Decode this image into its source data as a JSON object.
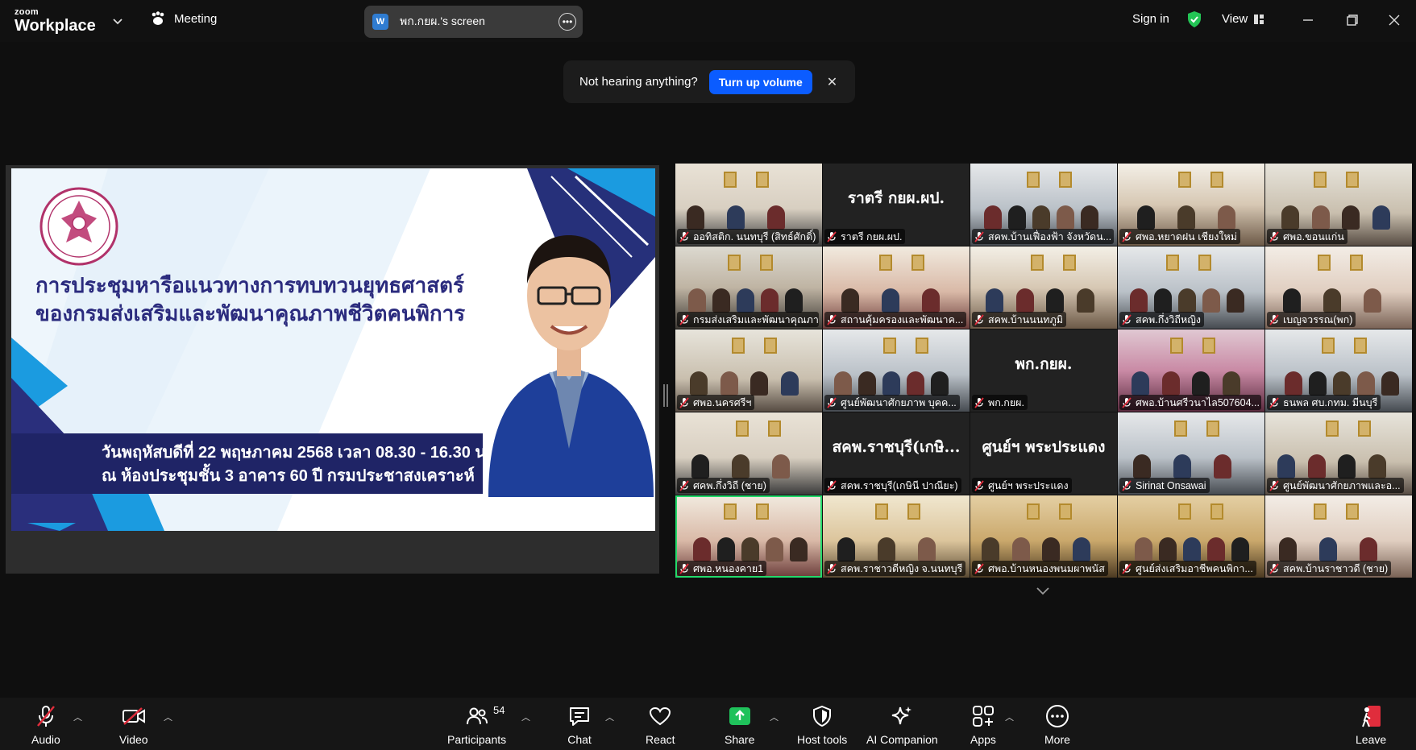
{
  "app": {
    "logo_small": "zoom",
    "logo_big": "Workplace",
    "meeting_label": "Meeting",
    "screen_share_badge": "W",
    "screen_share_title": "พก.กยผ.'s screen",
    "sign_in": "Sign in",
    "view": "View"
  },
  "notice": {
    "message": "Not hearing anything?",
    "button": "Turn up volume"
  },
  "slide": {
    "title_line1": "การประชุมหารือแนวทางการทบทวนยุทธศาสตร์",
    "title_line2": "ของกรมส่งเสริมและพัฒนาคุณภาพชีวิตคนพิการ",
    "date_line1": "วันพฤหัสบดีที่ 22 พฤษภาคม 2568 เวลา 08.30 - 16.30 น.",
    "date_line2": "ณ ห้องประชุมชั้น 3 อาคาร 60 ปี กรมประชาสงเคราะห์"
  },
  "gallery": {
    "tiles": [
      {
        "name": "ออทิสติก. นนทบุรี (สิทธ์ศักดิ์)",
        "big": "",
        "scene": "sc1"
      },
      {
        "name": "ราตรี กยผ.ผป.",
        "big": "ราตรี กยผ.ผป.",
        "scene": "dark"
      },
      {
        "name": "สคพ.บ้านเฟื่องฟ้า จังหวัดน...",
        "big": "",
        "scene": "sc6"
      },
      {
        "name": "ศพอ.หยาดฝน เชียงใหม่",
        "big": "",
        "scene": "sc2"
      },
      {
        "name": "ศพอ.ขอนแก่น",
        "big": "",
        "scene": "sc3"
      },
      {
        "name": "กรมส่งเสริมและพัฒนาคุณภา...",
        "big": "",
        "scene": "sc5"
      },
      {
        "name": "สถานคุ้มครองและพัฒนาค...",
        "big": "",
        "scene": "sc4"
      },
      {
        "name": "สคพ.บ้านนนทภูมิ",
        "big": "",
        "scene": "sc2"
      },
      {
        "name": "สคพ.กึ่งวิถีหญิง",
        "big": "",
        "scene": "sc6"
      },
      {
        "name": "เบญจวรรณ(พก)",
        "big": "",
        "scene": "sc10"
      },
      {
        "name": "ศพอ.นครศรีฯ",
        "big": "",
        "scene": "sc3"
      },
      {
        "name": "ศูนย์พัฒนาศักยภาพ บุคค...",
        "big": "",
        "scene": "sc6"
      },
      {
        "name": "พก.กยผ.",
        "big": "พก.กยผ.",
        "scene": "dark"
      },
      {
        "name": "ศพอ.บ้านศรีวนาไล507604...",
        "big": "",
        "scene": "sc7"
      },
      {
        "name": "ธนพล ศบ.กทม. มีนบุรี",
        "big": "",
        "scene": "sc6"
      },
      {
        "name": "ศคพ.กึ่งวิถี (ชาย)",
        "big": "",
        "scene": "sc1"
      },
      {
        "name": "สคพ.ราชบุรี(เกษินี ปาณียะ)",
        "big": "สคพ.ราชบุรี(เกษิ...",
        "scene": "dark"
      },
      {
        "name": "ศูนย์ฯ พระประแดง",
        "big": "ศูนย์ฯ พระประแดง",
        "scene": "dark"
      },
      {
        "name": "Sirinat Onsawai",
        "big": "",
        "scene": "sc6"
      },
      {
        "name": "ศูนย์พัฒนาศักยภาพและอ...",
        "big": "",
        "scene": "sc3"
      },
      {
        "name": "ศพอ.หนองคาย1",
        "big": "",
        "scene": "sc4"
      },
      {
        "name": "สคพ.ราชาวดีหญิง จ.นนทบุรี",
        "big": "",
        "scene": "sc8"
      },
      {
        "name": "ศพอ.บ้านหนองพนมผาพนัส",
        "big": "",
        "scene": "sc9"
      },
      {
        "name": "ศูนย์ส่งเสริมอาชีพคนพิกา...",
        "big": "",
        "scene": "sc9"
      },
      {
        "name": "สคพ.บ้านราชาวดี (ชาย)",
        "big": "",
        "scene": "sc10"
      }
    ]
  },
  "toolbar": {
    "audio": "Audio",
    "video": "Video",
    "participants": "Participants",
    "participants_count": "54",
    "chat": "Chat",
    "react": "React",
    "share": "Share",
    "host_tools": "Host tools",
    "ai_companion": "AI Companion",
    "apps": "Apps",
    "more": "More",
    "leave": "Leave"
  },
  "colors": {
    "accent_blue": "#0b5cff",
    "active_speaker": "#23d96b",
    "share_green": "#1fc25b",
    "leave_red": "#e02d3c",
    "muted_red": "#e02d3c"
  }
}
